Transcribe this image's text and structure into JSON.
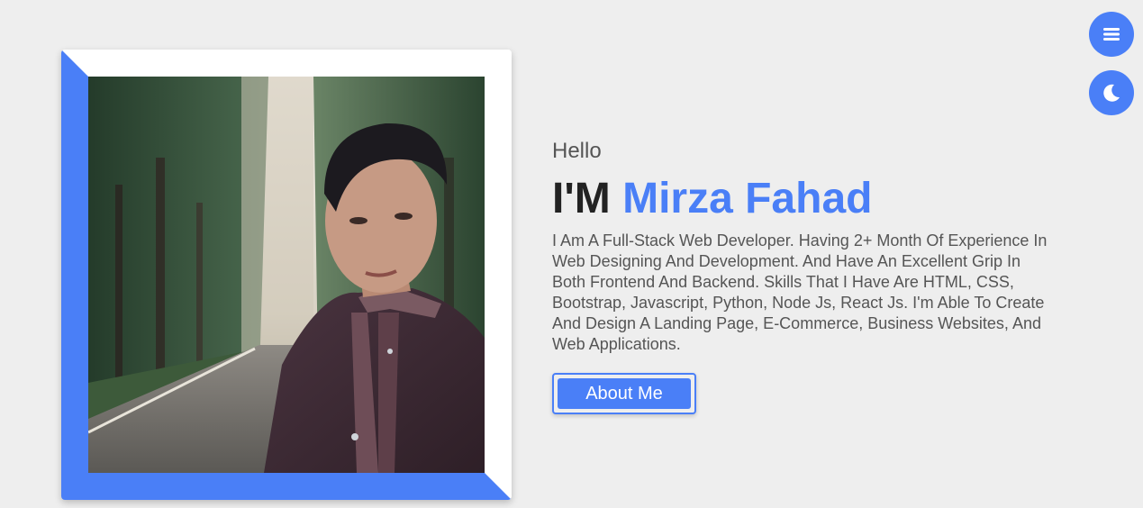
{
  "colors": {
    "accent": "#4a7ff7",
    "background": "#eeeeee",
    "text_dark": "#222222",
    "text_muted": "#555555"
  },
  "controls": {
    "menu_icon": "hamburger-menu-icon",
    "theme_icon": "moon-icon"
  },
  "hero": {
    "greeting": "Hello",
    "headline_prefix": "I'M",
    "name": "Mirza Fahad",
    "bio": "I Am A Full-Stack Web Developer. Having 2+ Month Of Experience In Web Designing And Development. And Have An Excellent Grip In Both Frontend And Backend. Skills That I Have Are HTML, CSS, Bootstrap, Javascript, Python, Node Js, React Js. I'm Able To Create And Design A Landing Page, E-Commerce, Business Websites, And Web Applications.",
    "about_button_label": "About Me"
  }
}
